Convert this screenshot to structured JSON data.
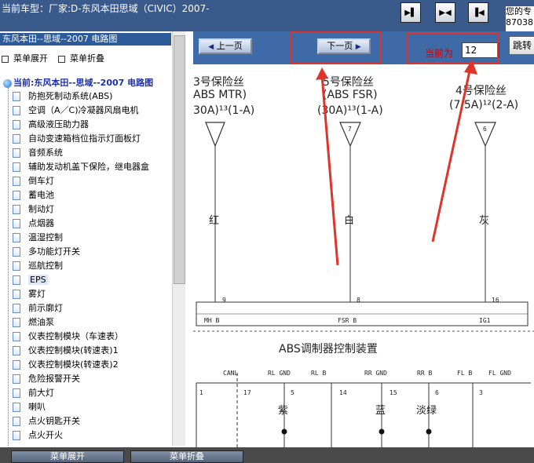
{
  "header": {
    "title": "当前车型：厂家:D-东风本田思域（CIVIC）2007-",
    "right_text_line1": "您的专",
    "right_text_line2": "87038"
  },
  "toolbar": {
    "btn1_icon": "arrow-right-icon",
    "btn2_icon": "arrows-expand-icon",
    "btn3_icon": "arrow-left-icon"
  },
  "sidebar": {
    "title": "东风本田--思域--2007 电路图",
    "expand_label": "菜单展开",
    "collapse_label": "菜单折叠",
    "current_label": "当前:东风本田--思域--2007 电路图",
    "items": [
      {
        "label": "防抱死制动系统(ABS)"
      },
      {
        "label": "空调（A／C)冷凝器风扇电机"
      },
      {
        "label": "高级液压助力器"
      },
      {
        "label": "自动变速箱档位指示灯面板灯"
      },
      {
        "label": "音频系统"
      },
      {
        "label": "辅助发动机盖下保险，继电器盒"
      },
      {
        "label": "倒车灯"
      },
      {
        "label": "蓄电池"
      },
      {
        "label": "制动灯"
      },
      {
        "label": "点烟器"
      },
      {
        "label": "温湿控制"
      },
      {
        "label": "多功能灯开关"
      },
      {
        "label": "巡航控制"
      },
      {
        "label": "EPS"
      },
      {
        "label": "雾灯"
      },
      {
        "label": "前示廓灯"
      },
      {
        "label": "燃油泵"
      },
      {
        "label": "仪表控制模块（车速表）"
      },
      {
        "label": "仪表控制模块(转速表)1"
      },
      {
        "label": "仪表控制模块(转速表)2"
      },
      {
        "label": "危险报警开关"
      },
      {
        "label": "前大灯"
      },
      {
        "label": "喇叭"
      },
      {
        "label": "点火钥匙开关"
      },
      {
        "label": "点火开火"
      }
    ]
  },
  "nav": {
    "prev_label": "上一页",
    "next_label": "下一页",
    "current_label": "当前为",
    "page_value": "12",
    "jump_label": "跳转"
  },
  "diagram": {
    "fuse1": {
      "line1": "3号保险丝",
      "line2": "ABS  MTR)",
      "line3": "30A)¹³(1-A)",
      "pin": "",
      "color": "红",
      "pin_bottom": "9",
      "wire_code": "MH  B"
    },
    "fuse2": {
      "line1": "5号保险丝",
      "line2": "(ABS  FSR)",
      "line3": "(30A)¹³(1-A)",
      "pin": "7",
      "color": "白",
      "pin_bottom": "8",
      "wire_code": "FSR  B"
    },
    "fuse3": {
      "line1": "4号保险丝",
      "line2": "(7.5A)¹²(2-A)",
      "line3": "",
      "pin": "6",
      "color": "灰",
      "pin_bottom": "16",
      "wire_code": "IG1"
    },
    "abs_title": "ABS调制器控制装置",
    "connector_labels": [
      "CANL",
      "RL  GND",
      "RL  B",
      "RR  GND",
      "RR  B",
      "FL  B",
      "FL  GND"
    ],
    "connector_pins": [
      "1",
      "17",
      "5",
      "14",
      "15",
      "6",
      "3"
    ],
    "lower_colors": [
      "紫",
      "蓝",
      "淡绿"
    ]
  },
  "bottom": {
    "btn1_label": "菜单展开",
    "btn2_label": "菜单折叠"
  }
}
